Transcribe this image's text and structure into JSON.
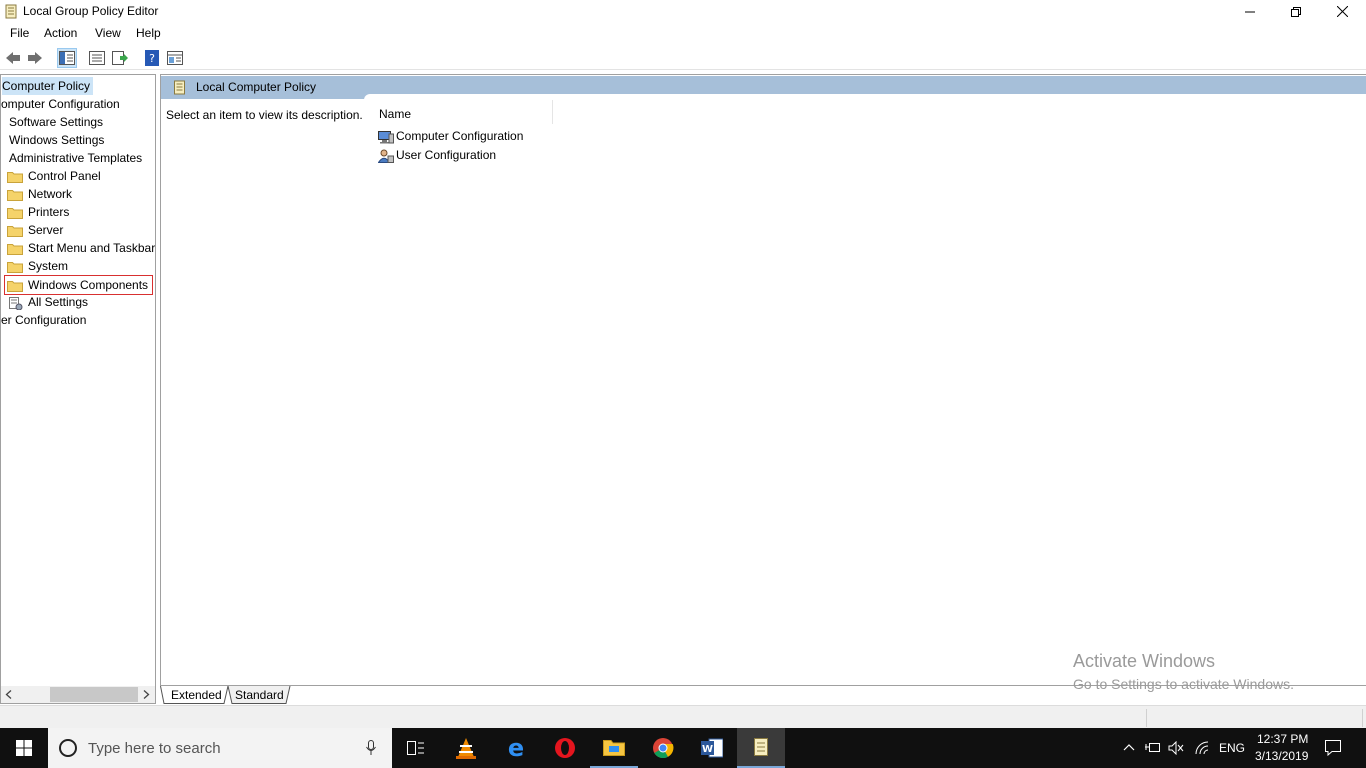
{
  "window": {
    "title": "Local Group Policy Editor"
  },
  "menu": [
    "File",
    "Action",
    "View",
    "Help"
  ],
  "tree": {
    "items": [
      {
        "label": "Computer Policy",
        "selected": true
      },
      {
        "label": "omputer Configuration"
      },
      {
        "label": "Software Settings"
      },
      {
        "label": "Windows Settings"
      },
      {
        "label": "Administrative Templates"
      },
      {
        "label": "Control Panel"
      },
      {
        "label": "Network"
      },
      {
        "label": "Printers"
      },
      {
        "label": "Server"
      },
      {
        "label": "Start Menu and Taskbar"
      },
      {
        "label": "System"
      },
      {
        "label": "Windows Components",
        "highlighted": true
      },
      {
        "label": "All Settings"
      },
      {
        "label": "er Configuration"
      }
    ]
  },
  "main": {
    "header": "Local Computer Policy",
    "description": "Select an item to view its description.",
    "column_name": "Name",
    "rows": [
      "Computer Configuration",
      "User Configuration"
    ]
  },
  "tabs": [
    "Extended",
    "Standard"
  ],
  "watermark": {
    "line1": "Activate Windows",
    "line2": "Go to Settings to activate Windows."
  },
  "taskbar": {
    "search_placeholder": "Type here to search",
    "language": "ENG",
    "time": "12:37 PM",
    "date": "3/13/2019"
  },
  "colors": {
    "pane_header": "#a6bfd9",
    "selection": "#cce4f7",
    "highlight_border": "#d83030",
    "taskbar": "#101010"
  }
}
